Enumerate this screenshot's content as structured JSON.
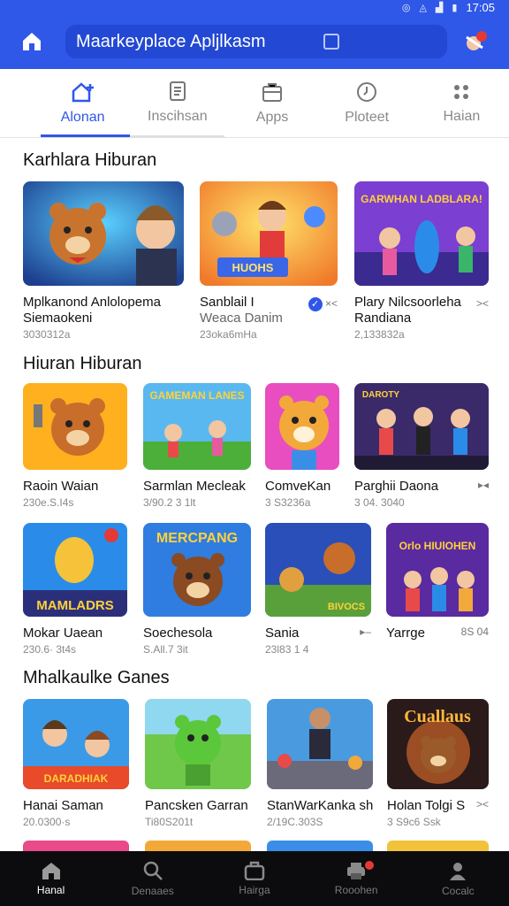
{
  "status_bar": {
    "time": "17:05",
    "icons": [
      "alarm-icon",
      "wifi-icon",
      "signal-icon",
      "battery-icon"
    ]
  },
  "header": {
    "search_text": "Maarkeyplace Apljlkasm",
    "icon": "home-icon",
    "avatar_icon": "avatar-icon"
  },
  "tabs": [
    {
      "label": "Alonan",
      "icon": "home-plus-icon",
      "active": true
    },
    {
      "label": "Inscihsan",
      "icon": "document-icon",
      "active": false
    },
    {
      "label": "Apps",
      "icon": "briefcase-icon",
      "active": false
    },
    {
      "label": "Ploteet",
      "icon": "clock-icon",
      "active": false
    },
    {
      "label": "Haian",
      "icon": "grid-icon",
      "active": false
    }
  ],
  "sections": [
    {
      "title": "Karhlara Hiburan",
      "cards": [
        {
          "title": "Mplkanond Anlolopema",
          "title2": "Siemaokeni",
          "sub": "3030312a",
          "meta": ""
        },
        {
          "title": "Sanblail I",
          "title2": "Weaca  Danim",
          "sub": "23oka6mHa",
          "meta": "×<"
        },
        {
          "title": "Plary Nilcsoorleha",
          "title2": "Randiana",
          "sub": "2,133832a",
          "meta": "><"
        }
      ]
    },
    {
      "title": "Hiuran Hiburan",
      "cards": [
        {
          "title": "Raoin Waian",
          "sub": "230e.S.I4s",
          "meta": ""
        },
        {
          "title": "Sarmlan Mecleak",
          "sub": "3/90.2 3 1lt",
          "meta": ""
        },
        {
          "title": "ComveKan",
          "sub": "3 S3236a",
          "meta": ""
        },
        {
          "title": "Parghii Daona",
          "sub": "3 04. 3040",
          "meta": "▸◂"
        },
        {
          "title": "Mokar Uaean",
          "sub": "230.6· 3t4s",
          "meta": ""
        },
        {
          "title": "Soechesola",
          "sub": "S.All.7 3it",
          "meta": ""
        },
        {
          "title": "Sania",
          "sub": "23l83 1 4",
          "meta": "▸–"
        },
        {
          "title": "Yarrge",
          "sub": "",
          "meta": "8S 04"
        }
      ]
    },
    {
      "title": "Mhalkaulke Ganes",
      "cards": [
        {
          "title": "Hanai Saman",
          "sub": "20.0300·s",
          "meta": ""
        },
        {
          "title": "Pancsken Garran",
          "sub": "Ti80S201t",
          "meta": ""
        },
        {
          "title": "StanWarKanka sh",
          "sub": "2/19C.303S",
          "meta": ""
        },
        {
          "title": "Holan Tolgi S",
          "sub": "3 S9c6 Ssk",
          "meta": "><"
        }
      ]
    }
  ],
  "thumb_texts": {
    "t1": "",
    "t2": "HUOHS",
    "t3": "GARWHAN LADBLARA!",
    "t4": "",
    "t5": "GAMEMAN LANES",
    "t6": "",
    "t7": "DAROTY",
    "t8": "MAMLADRS",
    "t9": "MERCPANG",
    "t10": "BIVOCS",
    "t11": "Orlo HIUlOHEN",
    "t12": "DARADHIAK",
    "t13": "",
    "t14": "",
    "t15": "Cuallaus"
  },
  "bottom_nav": [
    {
      "label": "Hanal",
      "icon": "home-icon",
      "active": true
    },
    {
      "label": "Denaaes",
      "icon": "search-icon",
      "active": false
    },
    {
      "label": "Hairga",
      "icon": "briefcase-icon",
      "active": false
    },
    {
      "label": "Rooohen",
      "icon": "printer-icon",
      "active": false,
      "badge": true
    },
    {
      "label": "Cocalc",
      "icon": "person-icon",
      "active": false
    }
  ],
  "colors": {
    "primary": "#2f57e8",
    "primary_dark": "#2248d4",
    "nav_bg": "#0c0c0e"
  }
}
